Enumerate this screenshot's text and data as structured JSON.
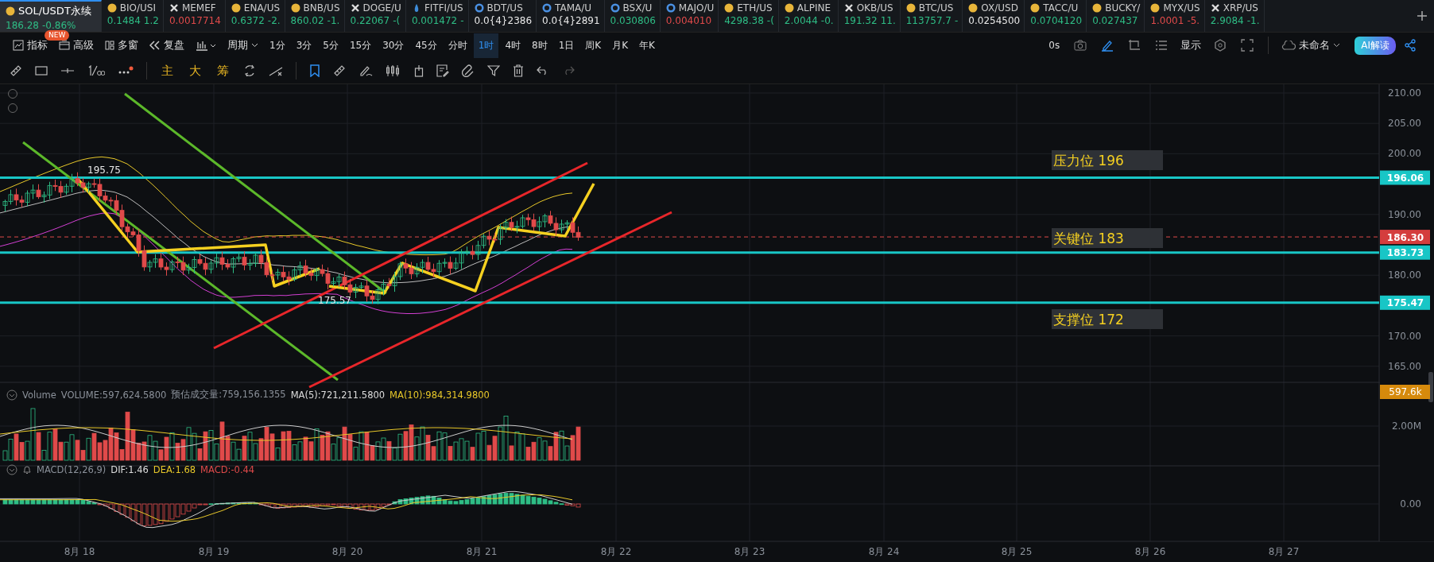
{
  "tickers": [
    {
      "symbol": "SOL/USDT永续",
      "price": "186.28",
      "change": "-0.86%",
      "color": "#2ebd85",
      "kind": "coin",
      "selected": true
    },
    {
      "symbol": "BIO/USI",
      "price": "0.1484",
      "change": "1.2",
      "color": "#2ebd85",
      "kind": "coin",
      "selected": false
    },
    {
      "symbol": "MEMEF",
      "price": "0.0017714",
      "color": "#e04a4a",
      "kind": "cross",
      "selected": false
    },
    {
      "symbol": "ENA/US",
      "price": "0.6372",
      "change": "-2.",
      "color": "#2ebd85",
      "kind": "coin",
      "selected": false
    },
    {
      "symbol": "BNB/US",
      "price": "860.02",
      "change": "-1.",
      "color": "#2ebd85",
      "kind": "coin",
      "selected": false
    },
    {
      "symbol": "DOGE/U",
      "price": "0.22067",
      "change": "-(",
      "color": "#2ebd85",
      "kind": "cross",
      "selected": false
    },
    {
      "symbol": "FITFI/US",
      "price": "0.001472",
      "change": "-",
      "color": "#2ebd85",
      "kind": "drop",
      "selected": false
    },
    {
      "symbol": "BDT/US",
      "price": "0.0{4}2386",
      "color": "#e8e8e8",
      "kind": "ring",
      "selected": false
    },
    {
      "symbol": "TAMA/U",
      "price": "0.0{4}2891",
      "color": "#e8e8e8",
      "kind": "ring",
      "selected": false
    },
    {
      "symbol": "BSX/U",
      "price": "0.030806",
      "color": "#2ebd85",
      "kind": "ring",
      "selected": false
    },
    {
      "symbol": "MAJO/U",
      "price": "0.004010",
      "color": "#e04a4a",
      "kind": "ring",
      "selected": false
    },
    {
      "symbol": "ETH/US",
      "price": "4298.38",
      "change": "-(",
      "color": "#2ebd85",
      "kind": "coin",
      "selected": false
    },
    {
      "symbol": "ALPINE",
      "price": "2.0044",
      "change": "-0.",
      "color": "#2ebd85",
      "kind": "coin",
      "selected": false
    },
    {
      "symbol": "OKB/US",
      "price": "191.32",
      "change": "11.",
      "color": "#2ebd85",
      "kind": "cross",
      "selected": false
    },
    {
      "symbol": "BTC/US",
      "price": "113757.7",
      "change": "-",
      "color": "#2ebd85",
      "kind": "coin",
      "selected": false
    },
    {
      "symbol": "OX/USD",
      "price": "0.0254500",
      "color": "#e8e8e8",
      "kind": "coin",
      "selected": false
    },
    {
      "symbol": "TACC/U",
      "price": "0.0704120",
      "color": "#2ebd85",
      "kind": "coin",
      "selected": false
    },
    {
      "symbol": "BUCKY/",
      "price": "0.027437",
      "color": "#2ebd85",
      "kind": "coin",
      "selected": false
    },
    {
      "symbol": "MYX/US",
      "price": "1.0001",
      "change": "-5.",
      "color": "#e04a4a",
      "kind": "coin",
      "selected": false
    },
    {
      "symbol": "XRP/US",
      "price": "2.9084",
      "change": "-1.",
      "color": "#2ebd85",
      "kind": "cross",
      "selected": false
    }
  ],
  "new_badge": "NEW",
  "toolbar": {
    "tools": [
      "指标",
      "高级",
      "多窗",
      "复盘"
    ],
    "period_menu": "周期",
    "periods": [
      {
        "label": "1分",
        "selected": false
      },
      {
        "label": "3分",
        "selected": false
      },
      {
        "label": "5分",
        "selected": false
      },
      {
        "label": "15分",
        "selected": false
      },
      {
        "label": "30分",
        "selected": false
      },
      {
        "label": "45分",
        "selected": false
      },
      {
        "label": "分时",
        "selected": false
      },
      {
        "label": "1时",
        "selected": true
      },
      {
        "label": "4时",
        "selected": false
      },
      {
        "label": "8时",
        "selected": false
      },
      {
        "label": "1日",
        "selected": false
      },
      {
        "label": "周K",
        "selected": false
      },
      {
        "label": "月K",
        "selected": false
      },
      {
        "label": "年K",
        "selected": false
      }
    ],
    "timer": "0s",
    "display": "显示",
    "layout_name": "未命名",
    "ai_button": "AI解读"
  },
  "draw_toolbar": {
    "indicators": [
      "主",
      "大",
      "筹"
    ]
  },
  "chart": {
    "price_ticks": [
      "210.00",
      "205.00",
      "200.00",
      "190.00",
      "180.00",
      "170.00",
      "165.00"
    ],
    "markers": [
      {
        "label": "196.06",
        "kind": "level"
      },
      {
        "label": "186.30",
        "kind": "last"
      },
      {
        "label": "183.73",
        "kind": "level"
      },
      {
        "label": "175.47",
        "kind": "level"
      }
    ],
    "level_labels": [
      "压力位 196",
      "关键位 183",
      "支撑位 172"
    ],
    "high_label": "195.75",
    "low_label": "175.57",
    "volume_legend": {
      "name": "Volume",
      "volume": "VOLUME:597,624.5800",
      "estimate": "预估成交量:759,156.1355",
      "ma5": "MA(5):721,211.5800",
      "ma10": "MA(10):984,314.9800"
    },
    "volume_ticks": [
      "2.00M"
    ],
    "volume_marker": "597.6k",
    "macd_legend": {
      "name": "MACD(12,26,9)",
      "dif": "DIF:1.46",
      "dea": "DEA:1.68",
      "macd": "MACD:-0.44"
    },
    "macd_ticks": [
      "0.00"
    ],
    "dates": [
      "8月 18",
      "8月 19",
      "8月 20",
      "8月 21",
      "8月 22",
      "8月 23",
      "8月 24",
      "8月 25",
      "8月 26",
      "8月 27"
    ]
  }
}
